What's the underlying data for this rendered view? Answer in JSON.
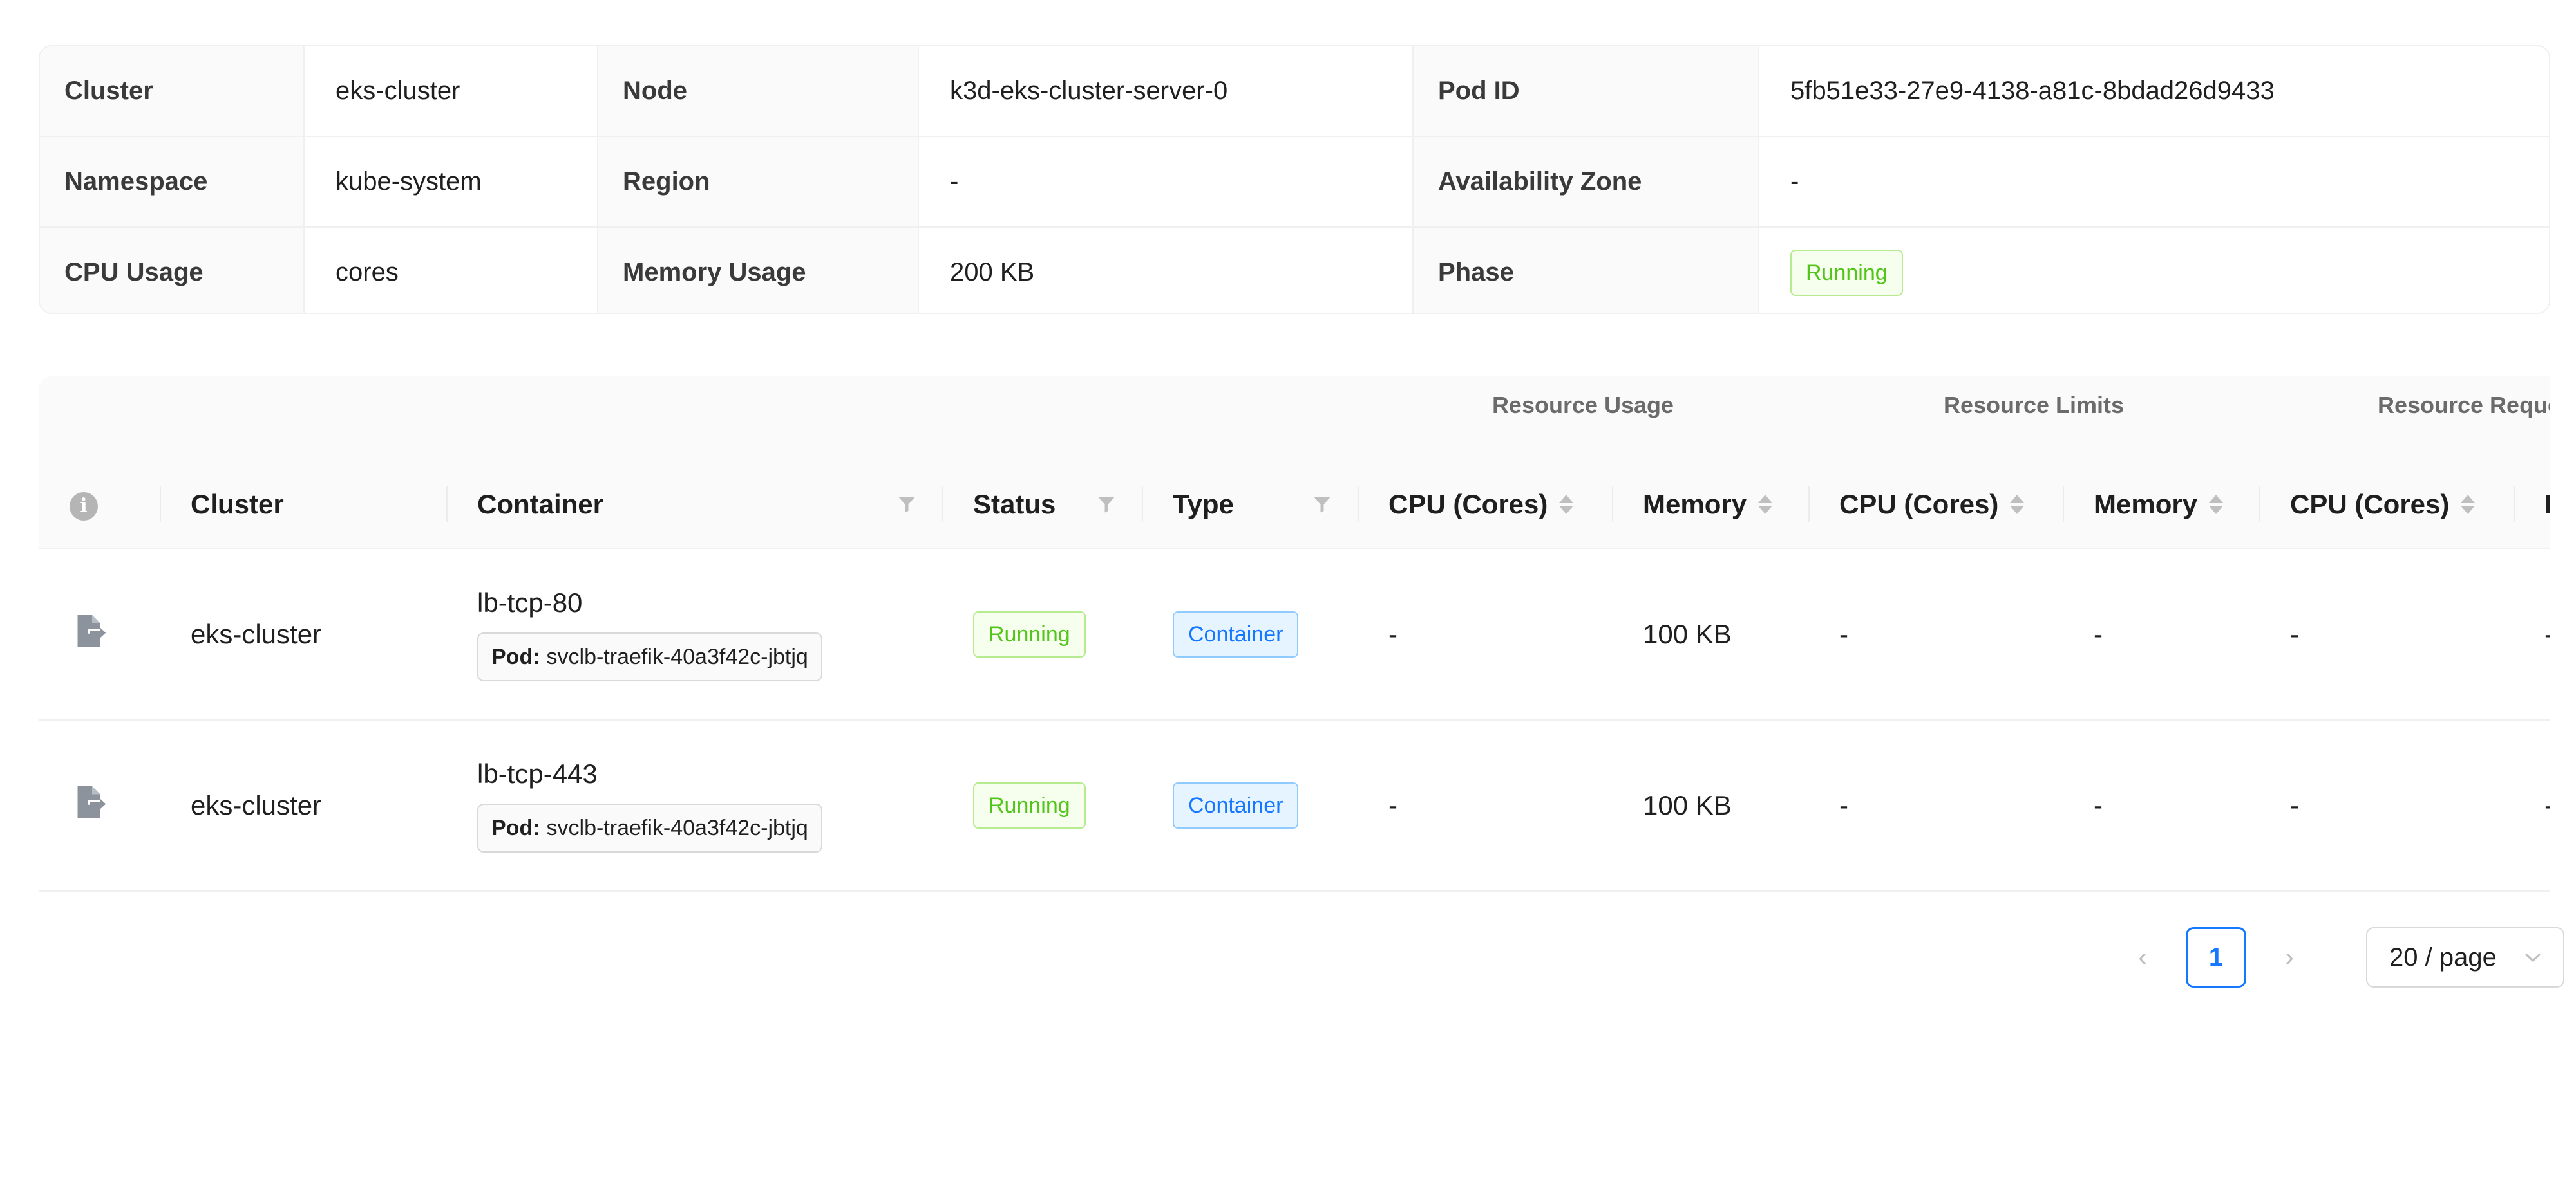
{
  "details": {
    "rows": [
      [
        {
          "label": "Cluster",
          "value": "eks-cluster"
        },
        {
          "label": "Node",
          "value": "k3d-eks-cluster-server-0"
        },
        {
          "label": "Pod ID",
          "value": "5fb51e33-27e9-4138-a81c-8bdad26d9433"
        }
      ],
      [
        {
          "label": "Namespace",
          "value": "kube-system"
        },
        {
          "label": "Region",
          "value": "-"
        },
        {
          "label": "Availability Zone",
          "value": "-"
        }
      ],
      [
        {
          "label": "CPU Usage",
          "value": "cores"
        },
        {
          "label": "Memory Usage",
          "value": "200 KB"
        },
        {
          "label": "Phase",
          "value": "Running"
        }
      ]
    ]
  },
  "containers": {
    "group_headers": {
      "usage": "Resource Usage",
      "limits": "Resource Limits",
      "requests": "Resource Reque"
    },
    "columns": {
      "cluster": "Cluster",
      "container": "Container",
      "status": "Status",
      "type": "Type",
      "usage_cpu": "CPU (Cores)",
      "usage_memory": "Memory",
      "limits_cpu": "CPU (Cores)",
      "limits_memory": "Memory",
      "requests_cpu": "CPU (Cores)",
      "requests_memory": "M"
    },
    "rows": [
      {
        "cluster": "eks-cluster",
        "container": "lb-tcp-80",
        "pod_label": "Pod:",
        "pod": "svclb-traefik-40a3f42c-jbtjq",
        "status": "Running",
        "type": "Container",
        "usage_cpu": "-",
        "usage_memory": "100 KB",
        "limits_cpu": "-",
        "limits_memory": "-",
        "requests_cpu": "-",
        "requests_memory": "-"
      },
      {
        "cluster": "eks-cluster",
        "container": "lb-tcp-443",
        "pod_label": "Pod:",
        "pod": "svclb-traefik-40a3f42c-jbtjq",
        "status": "Running",
        "type": "Container",
        "usage_cpu": "-",
        "usage_memory": "100 KB",
        "limits_cpu": "-",
        "limits_memory": "-",
        "requests_cpu": "-",
        "requests_memory": "-"
      }
    ]
  },
  "pagination": {
    "prev": "‹",
    "current": "1",
    "next": "›",
    "page_size": "20 / page"
  },
  "colors": {
    "accent": "#1677ff",
    "success": "#52c41a",
    "header_bg": "#fafafa",
    "border": "#f0f0f0"
  }
}
